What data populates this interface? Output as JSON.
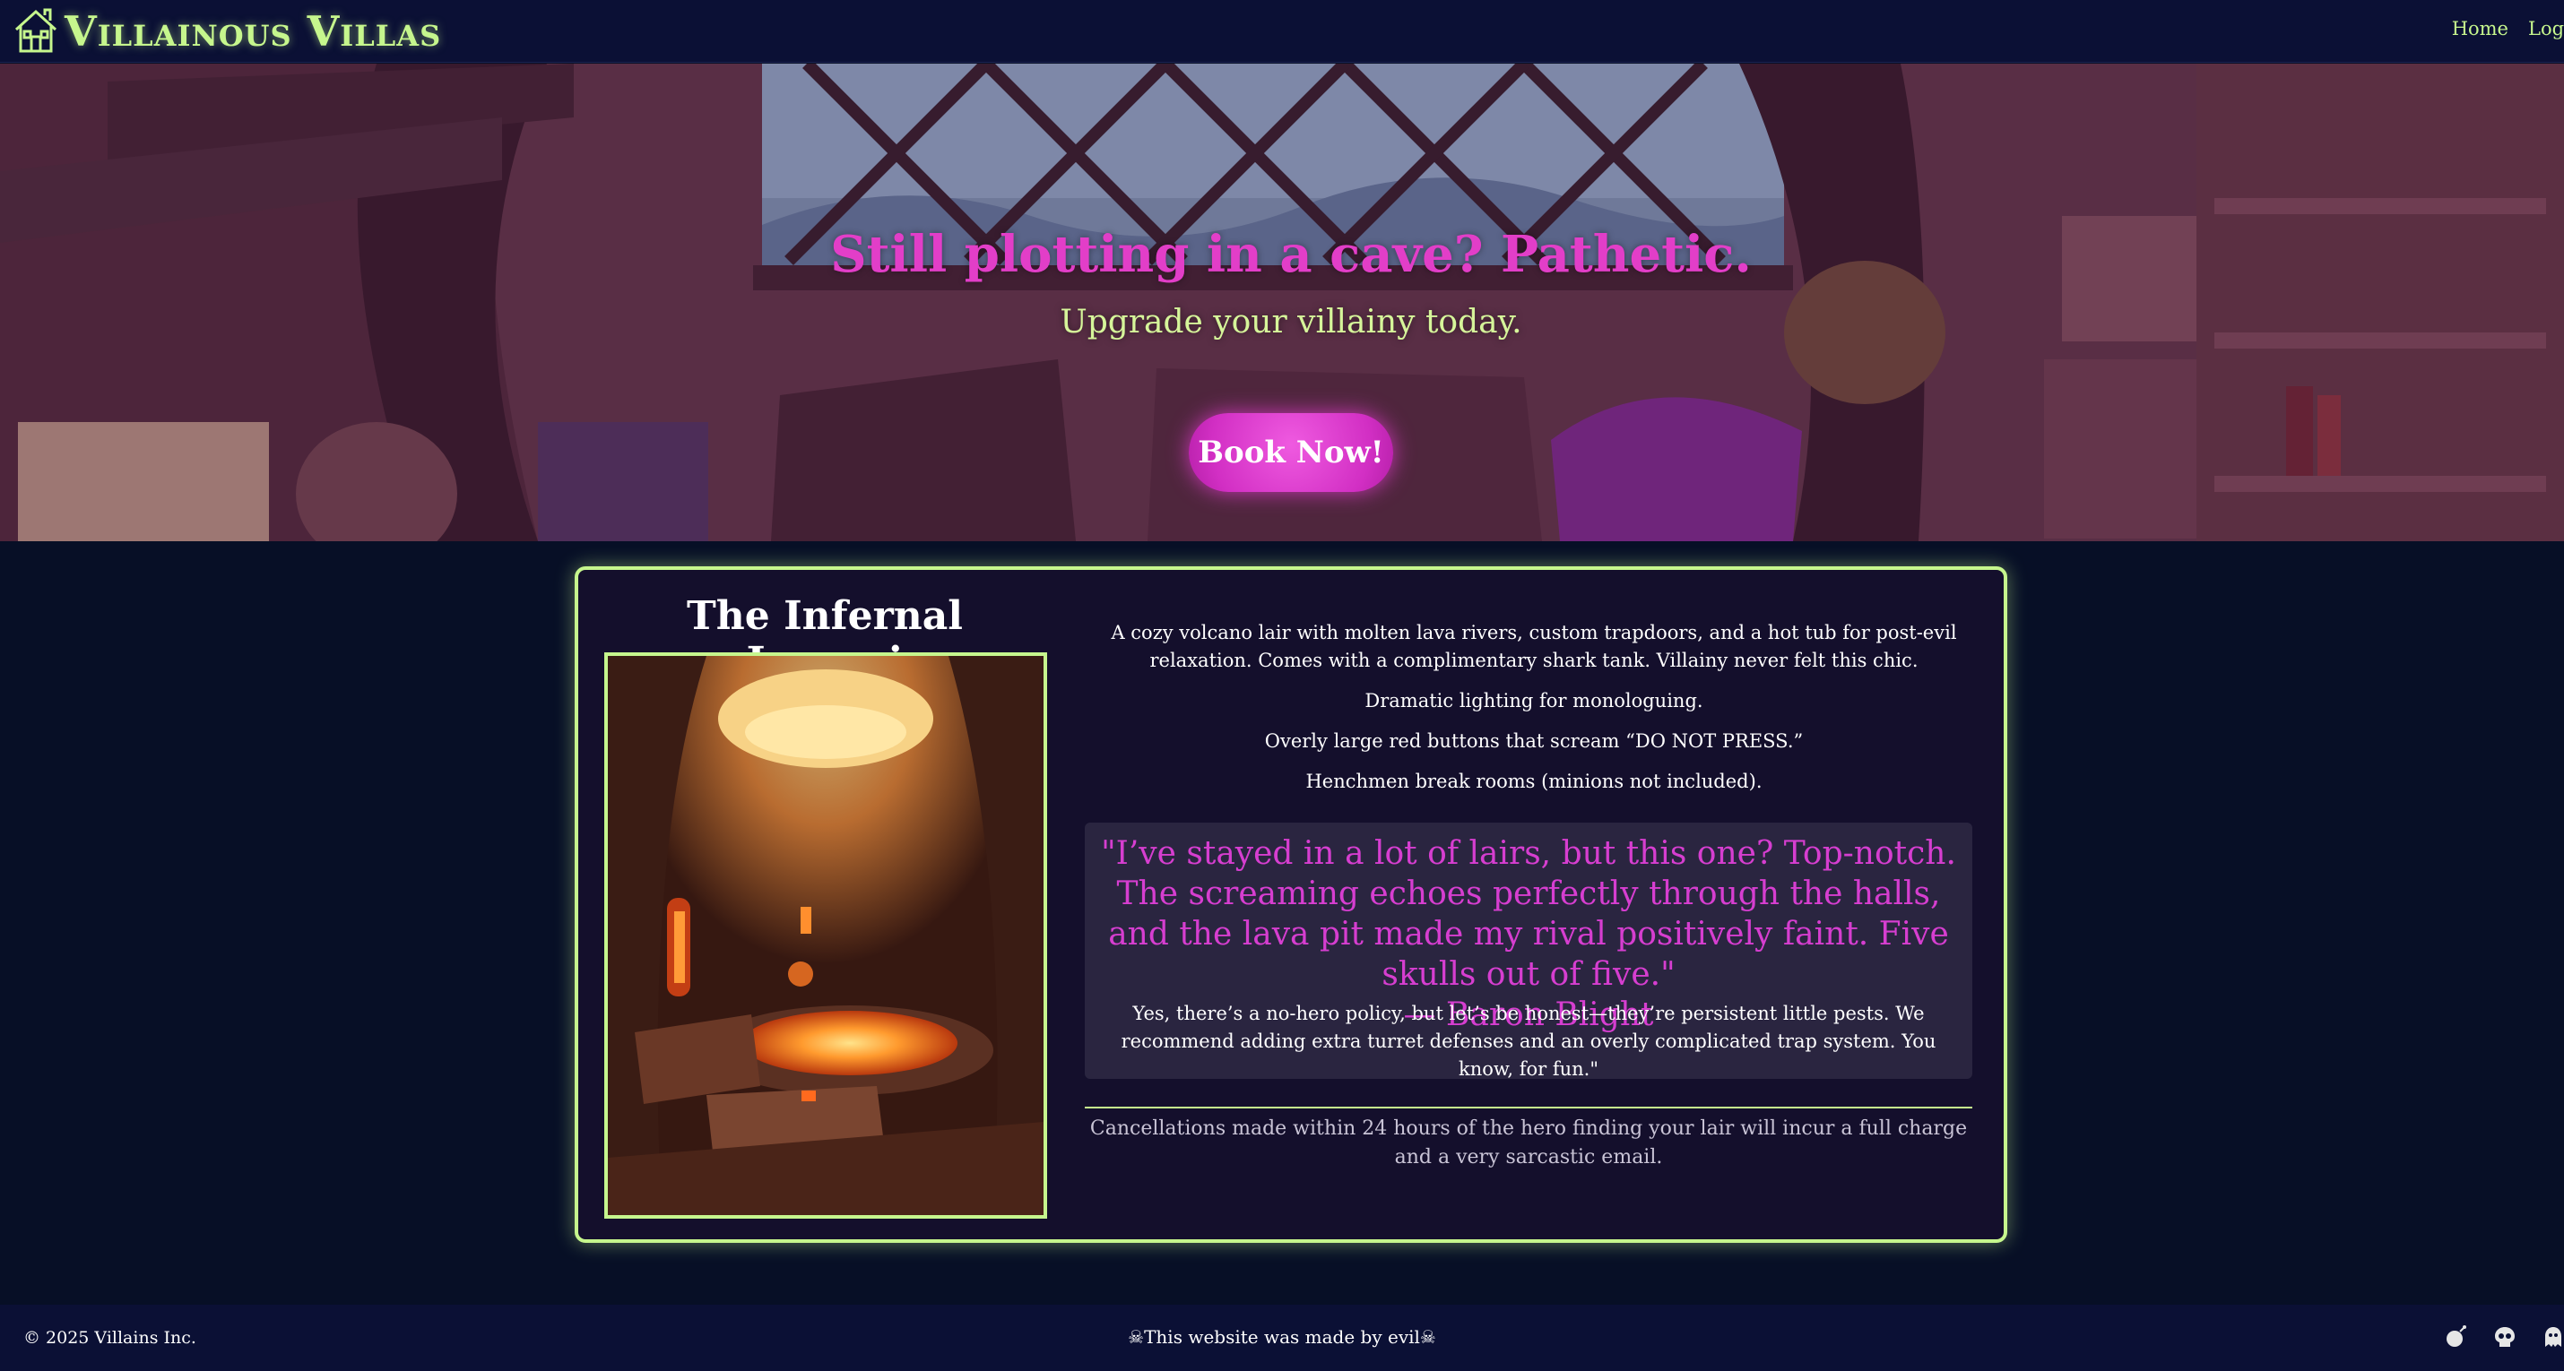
{
  "header": {
    "brand": "Villainous Villas",
    "nav": {
      "home": "Home",
      "login": "Login"
    }
  },
  "hero": {
    "title": "Still plotting in a cave? Pathetic.",
    "subtitle": "Upgrade your villainy today.",
    "cta": "Book Now!"
  },
  "listing": {
    "title": "The Infernal Jacuzzi",
    "intro": "A cozy volcano lair with molten lava rivers, custom trapdoors, and a hot tub for post-evil relaxation. Comes with a complimentary shark tank. Villainy never felt this chic.",
    "features": [
      "Dramatic lighting for monologuing.",
      "Overly large red buttons that scream “DO NOT PRESS.”",
      "Henchmen break rooms (minions not included)."
    ],
    "review": {
      "quote": "\"I’ve stayed in a lot of lairs, but this one? Top-notch. The screaming echoes perfectly through the halls, and the lava pit made my rival positively faint. Five skulls out of five.\"",
      "author": "— Baron Blight",
      "body": "Yes, there’s a no-hero policy, but let’s be honest—they’re persistent little pests. We recommend adding extra turret defenses and an overly complicated trap system. You know, for fun.\""
    },
    "cancellation": "Cancellations made within 24 hours of the hero finding your lair will incur a full charge and a very sarcastic email."
  },
  "footer": {
    "copyright": "© 2025 Villains Inc.",
    "made_by": "☠This website was made by evil☠",
    "icons": [
      "bomb-icon",
      "skull-icon",
      "ghost-icon"
    ]
  },
  "colors": {
    "accent_green": "#c6f68d",
    "accent_magenta": "#e23ec8",
    "background": "#070f26",
    "header_bg": "#0b1035",
    "card_bg": "#140f2c"
  }
}
